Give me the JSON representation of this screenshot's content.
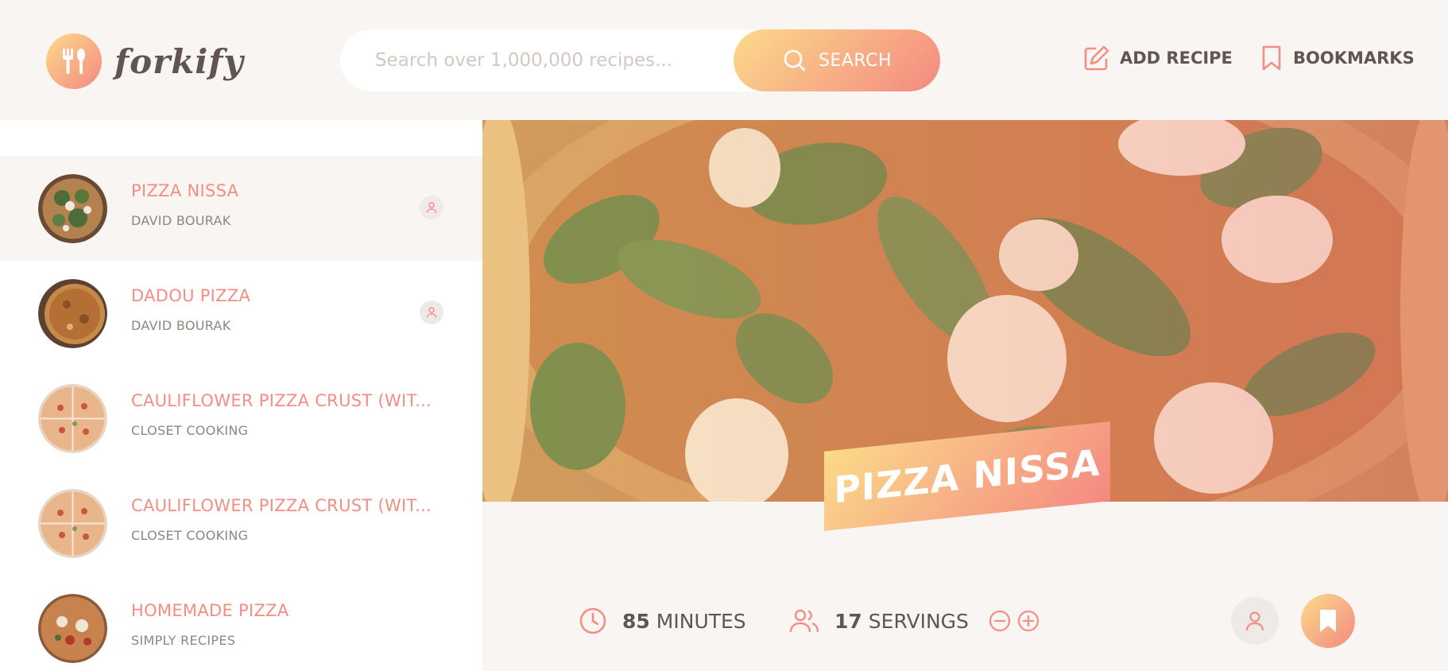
{
  "app": {
    "name": "forkify"
  },
  "header": {
    "search_placeholder": "Search over 1,000,000 recipes...",
    "search_button": "SEARCH",
    "nav": {
      "add_recipe": "ADD RECIPE",
      "bookmarks": "BOOKMARKS"
    }
  },
  "results": [
    {
      "title": "PIZZA NISSA",
      "publisher": "DAVID BOURAK",
      "user_generated": true,
      "active": true
    },
    {
      "title": "DADOU PIZZA",
      "publisher": "DAVID BOURAK",
      "user_generated": true,
      "active": false
    },
    {
      "title": "CAULIFLOWER PIZZA CRUST (WIT...",
      "publisher": "CLOSET COOKING",
      "user_generated": false,
      "active": false
    },
    {
      "title": "CAULIFLOWER PIZZA CRUST (WIT...",
      "publisher": "CLOSET COOKING",
      "user_generated": false,
      "active": false
    },
    {
      "title": "HOMEMADE PIZZA",
      "publisher": "SIMPLY RECIPES",
      "user_generated": false,
      "active": false
    }
  ],
  "recipe": {
    "title": "PIZZA NISSA",
    "cooking_time": "85",
    "cooking_time_unit": "MINUTES",
    "servings": "17",
    "servings_unit": "SERVINGS"
  },
  "colors": {
    "accent_start": "#fbdb89",
    "accent_end": "#f48982",
    "text": "#615551",
    "title_pink": "#f38e82"
  },
  "icons": [
    "fork-knife-icon",
    "search-icon",
    "edit-icon",
    "bookmark-icon",
    "user-icon",
    "clock-icon",
    "users-icon",
    "minus-circle-icon",
    "plus-circle-icon"
  ]
}
